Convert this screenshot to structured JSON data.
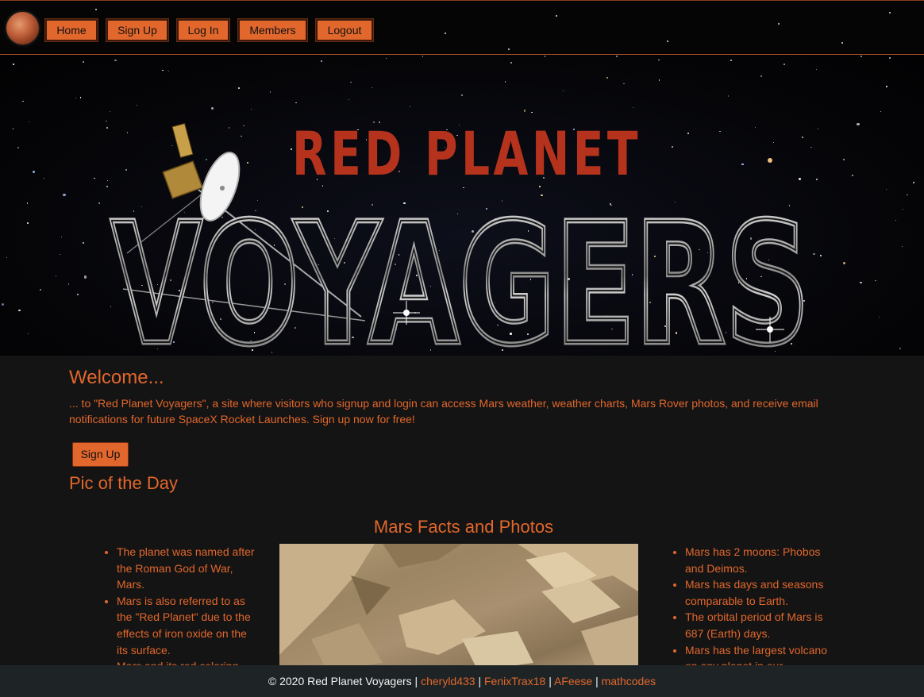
{
  "nav": {
    "items": [
      {
        "label": "Home"
      },
      {
        "label": "Sign Up"
      },
      {
        "label": "Log In"
      },
      {
        "label": "Members"
      },
      {
        "label": "Logout"
      }
    ]
  },
  "hero": {
    "title_line1": "RED PLANET",
    "title_line2": "VOYAGERS"
  },
  "welcome": {
    "title": "Welcome...",
    "text": "... to \"Red Planet Voyagers\", a site where visitors who signup and login can access Mars weather, weather charts, Mars Rover photos, and receive email notifications for future SpaceX Rocket Launches. Sign up now for free!",
    "signup_label": "Sign Up"
  },
  "potd": {
    "title": "Pic of the Day"
  },
  "facts": {
    "title": "Mars Facts and Photos",
    "left": [
      "The planet was named after the Roman God of War, Mars.",
      "Mars is also referred to as the \"Red Planet\" due to the effects of iron oxide on the its surface.",
      "Mars and its red coloring"
    ],
    "right": [
      "Mars has 2 moons: Phobos and Deimos.",
      "Mars has days and seasons comparable to Earth.",
      "The orbital period of Mars is 687 (Earth) days.",
      "Mars has the largest volcano on any planet in our"
    ]
  },
  "footer": {
    "copyright": "© 2020 Red Planet Voyagers",
    "sep": "|",
    "links": [
      "cheryld433",
      "FenixTrax18",
      "AFeese",
      "mathcodes"
    ]
  },
  "colors": {
    "accent": "#e2672c",
    "title_red": "#b5321c",
    "background": "#141414",
    "footer_bg": "#1e2426"
  }
}
